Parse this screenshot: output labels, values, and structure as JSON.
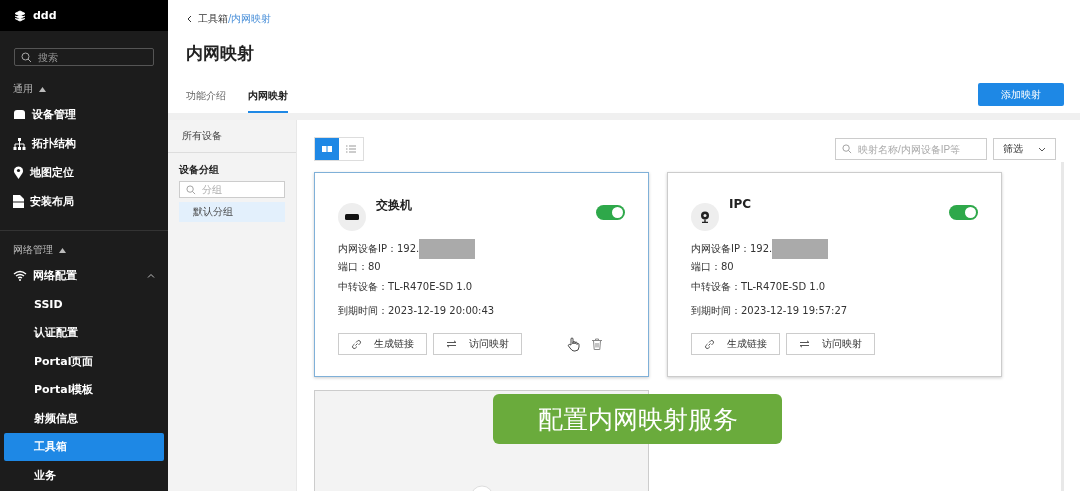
{
  "sidebar": {
    "org": "ddd",
    "search": {
      "placeholder": "搜索"
    },
    "sections": [
      {
        "title": "通用",
        "expanded": true,
        "items": [
          {
            "label": "设备管理",
            "kind": "device",
            "selected": false
          },
          {
            "label": "拓扑结构",
            "kind": "topology",
            "selected": false
          },
          {
            "label": "地图定位",
            "kind": "pin",
            "selected": false
          },
          {
            "label": "安装布局",
            "kind": "doc",
            "selected": false
          }
        ]
      },
      {
        "title": "网络管理",
        "expanded": true,
        "items": [
          {
            "label": "网络配置",
            "kind": "wifi",
            "selected": false,
            "expanded": true,
            "children": [
              {
                "label": "SSID",
                "selected": false
              },
              {
                "label": "认证配置",
                "selected": false
              },
              {
                "label": "Portal页面",
                "selected": false
              },
              {
                "label": "Portal模板",
                "selected": false
              },
              {
                "label": "射频信息",
                "selected": false
              },
              {
                "label": "工具箱",
                "selected": true
              },
              {
                "label": "业务",
                "selected": false
              }
            ]
          }
        ]
      }
    ]
  },
  "breadcrumb": {
    "back": "工具箱",
    "current": "/内网映射"
  },
  "page_title": "内网映射",
  "tabs": [
    {
      "label": "功能介绍",
      "selected": false
    },
    {
      "label": "内网映射",
      "selected": true
    }
  ],
  "add_button": "添加映射",
  "groups": {
    "all": "所有设备",
    "title": "设备分组",
    "search": {
      "placeholder": "分组"
    },
    "items": [
      {
        "label": "默认分组",
        "selected": true
      }
    ]
  },
  "views": [
    {
      "kind": "grid",
      "selected": true
    },
    {
      "kind": "list",
      "selected": false
    }
  ],
  "search": {
    "placeholder": "映射名称/内网设备IP等"
  },
  "filter": "筛选",
  "cards": [
    {
      "name": "交换机",
      "kind": "switch",
      "on": true,
      "highlighted": true,
      "ip_label": "内网设备IP：",
      "ip": "192.",
      "redacted": true,
      "port": "端口：80",
      "relay": "中转设备：TL-R470E-SD 1.0",
      "expiry": "到期时间：2023-12-19 20:00:43",
      "link_button": "生成链接",
      "visit_button": "访问映射"
    },
    {
      "name": "IPC",
      "kind": "camera",
      "on": true,
      "highlighted": false,
      "ip_label": "内网设备IP：",
      "ip": "192.",
      "redacted": true,
      "port": "端口：80",
      "relay": "中转设备：TL-R470E-SD 1.0",
      "expiry": "到期时间：2023-12-19 19:57:27",
      "link_button": "生成链接",
      "visit_button": "访问映射"
    }
  ],
  "caption": "配置内网映射服务"
}
